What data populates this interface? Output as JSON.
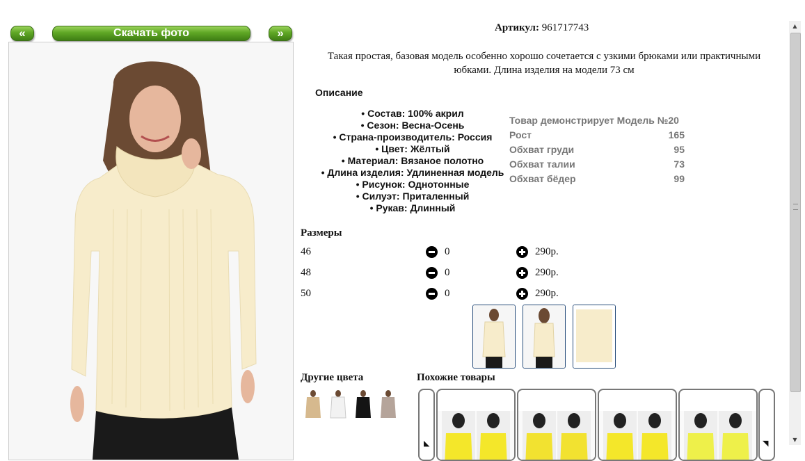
{
  "gallery": {
    "prev_label": "«",
    "download_label": "Скачать фото",
    "next_label": "»"
  },
  "product": {
    "article_label": "Артикул:",
    "article_value": "961717743",
    "summary": "Такая простая, базовая модель особенно хорошо сочетается с узкими брюками или практичными юбками. Длина изделия на модели 73 см",
    "description_heading": "Описание",
    "attributes": [
      "• Состав: 100% акрил",
      "• Сезон: Весна-Осень",
      "• Страна-производитель: Россия",
      "• Цвет: Жёлтый",
      "• Материал: Вязаное полотно",
      "• Длина изделия: Удлиненная модель",
      "• Рисунок: Однотонные",
      "• Силуэт: Приталенный",
      "• Рукав: Длинный"
    ]
  },
  "model": {
    "title": "Товар демонстрирует Модель №20",
    "rows": [
      {
        "label": "Рост",
        "value": "165"
      },
      {
        "label": "Обхват груди",
        "value": "95"
      },
      {
        "label": "Обхват талии",
        "value": "73"
      },
      {
        "label": "Обхват бёдер",
        "value": "99"
      }
    ]
  },
  "sizes": {
    "heading": "Размеры",
    "rows": [
      {
        "size": "46",
        "qty": "0",
        "price": "290р."
      },
      {
        "size": "48",
        "qty": "0",
        "price": "290р."
      },
      {
        "size": "50",
        "qty": "0",
        "price": "290р."
      }
    ]
  },
  "other_colors": {
    "heading": "Другие цвета"
  },
  "similar": {
    "heading": "Похожие товары"
  },
  "colors": {
    "sweater": "#f7eccb",
    "jeans": "#1a1a1a",
    "hair": "#6b4a33",
    "skin": "#e6b79d",
    "green": "#5fa725",
    "yellow_item": "#f4e72a",
    "thumb_border": "#274c7a"
  }
}
